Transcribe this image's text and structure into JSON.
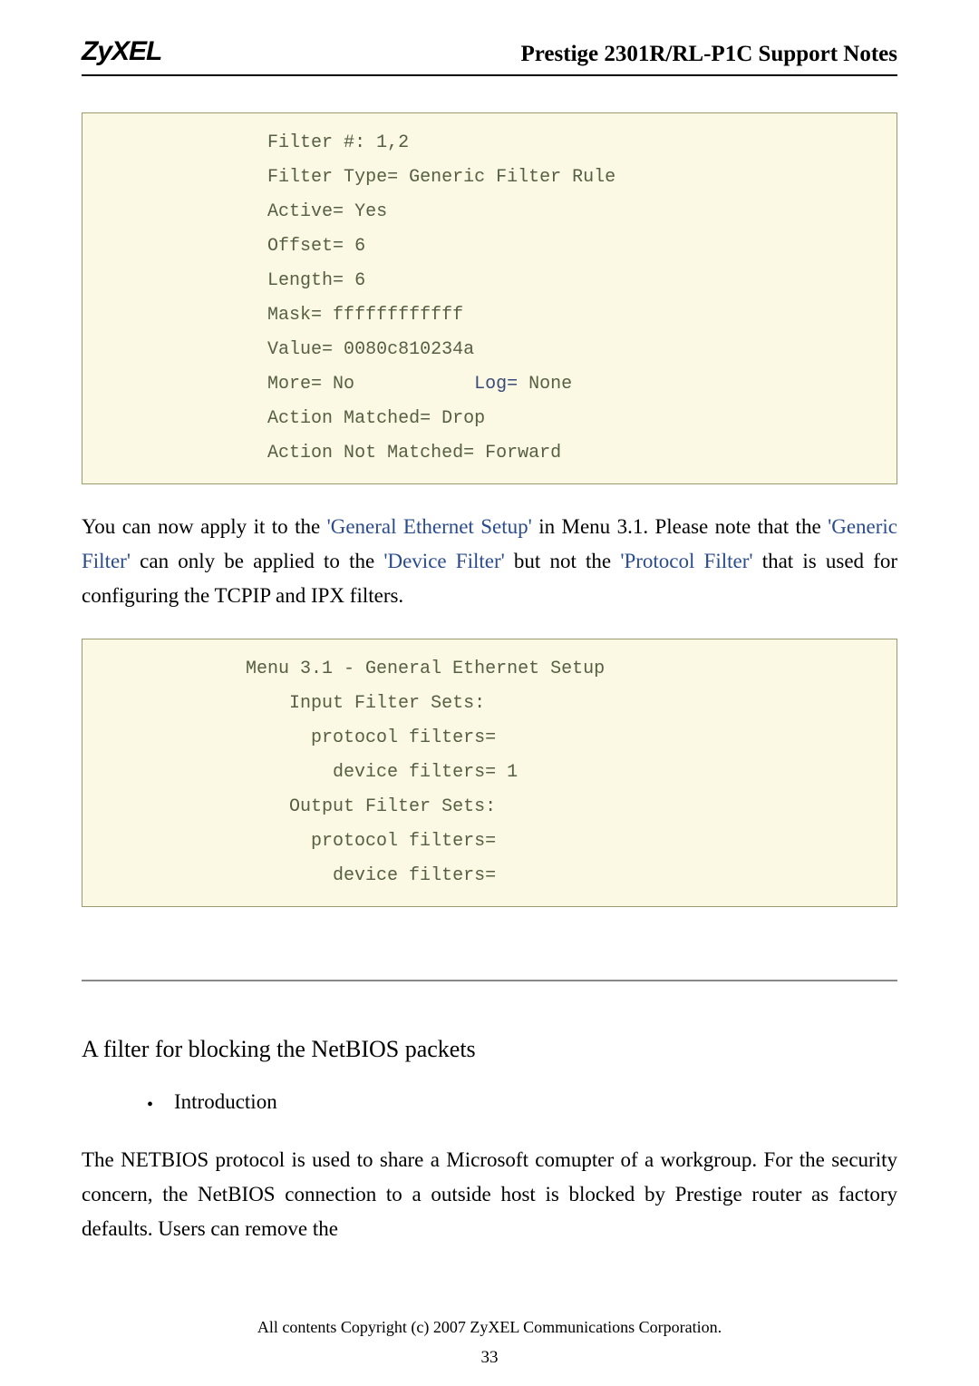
{
  "header": {
    "logo": "ZyXEL",
    "title": "Prestige 2301R/RL-P1C Support Notes"
  },
  "block1": {
    "indent": "                 ",
    "lines": {
      "l1": "Filter #: 1,2",
      "l2": "Filter Type= Generic Filter Rule",
      "l3": "Active= Yes",
      "l4": "Offset= 6",
      "l5": "Length= 6",
      "l6": "Mask= ffffffffffff",
      "l7": "Value= 0080c810234a",
      "l8a": "More= No           ",
      "l8b": "Log= ",
      "l8c": "None",
      "l9": "Action Matched= Drop",
      "l10": "Action Not Matched= Forward"
    }
  },
  "para1": {
    "t1": "You can now apply it to the ",
    "b1": "'General Ethernet Setup'",
    "t2": " in Menu 3.1. Please note that the ",
    "b2": "'Generic Filter'",
    "t3": " can only be applied to the ",
    "b3": "'Device Filter'",
    "t4": " but not the ",
    "b4": "'Protocol Filter'",
    "t5": " that is used for configuring the TCPIP and IPX filters."
  },
  "block2": {
    "l1": "               Menu 3.1 - General Ethernet Setup",
    "l2": "                   Input Filter Sets:",
    "l3": "                     protocol filters=",
    "l4": "                       device filters= 1",
    "l5": "                   Output Filter Sets:",
    "l6": "                     protocol filters=",
    "l7": "                       device filters="
  },
  "section": {
    "heading": "A filter for blocking the NetBIOS packets",
    "bullet": "Introduction"
  },
  "para2": "The NETBIOS protocol is used to share a Microsoft comupter of a workgroup. For the security concern, the NetBIOS connection to a outside host is blocked by Prestige router as factory defaults. Users can remove the",
  "footer": {
    "copyright": "All contents Copyright (c) 2007 ZyXEL Communications Corporation.",
    "page": "33"
  }
}
